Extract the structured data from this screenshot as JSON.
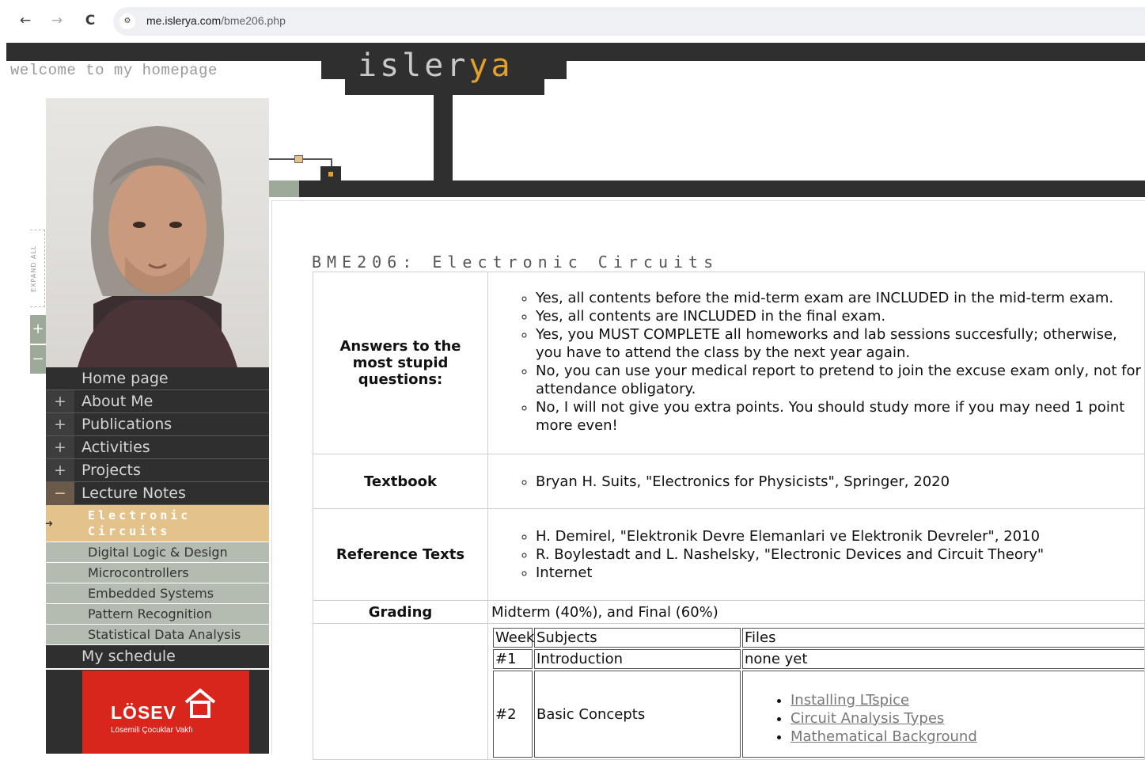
{
  "browser": {
    "url_host": "me.islerya.com",
    "url_path": "/bme206.php",
    "back_icon": "←",
    "forward_icon": "→",
    "reload_icon": "C",
    "site_info_icon": "⚙"
  },
  "header": {
    "welcome": "welcome to my homepage",
    "logo_main": "isler",
    "logo_accent": "ya",
    "accent_color": "#e3a12a"
  },
  "sidebar": {
    "expand_all": "EXPAND ALL",
    "plus": "+",
    "minus": "−",
    "menu": [
      {
        "label": "Home page",
        "sign": ""
      },
      {
        "label": "About Me",
        "sign": "+"
      },
      {
        "label": "Publications",
        "sign": "+"
      },
      {
        "label": "Activities",
        "sign": "+"
      },
      {
        "label": "Projects",
        "sign": "+"
      },
      {
        "label": "Lecture Notes",
        "sign": "−"
      }
    ],
    "lecture_notes": [
      "Electronic Circuits",
      "Digital Logic & Design",
      "Microcontrollers",
      "Embedded Systems",
      "Pattern Recognition",
      "Statistical Data Analysis"
    ],
    "schedule": "My schedule",
    "banner_name": "LÖSEV",
    "banner_sub": "Lösemili Çocuklar Vakfı"
  },
  "content": {
    "title": "BME206: Electronic Circuits",
    "rows": {
      "answers_label": "Answers to the most stupid questions:",
      "answers": [
        "Yes, all contents before the mid-term exam are INCLUDED in the mid-term exam.",
        "Yes, all contents are INCLUDED in the final exam.",
        "Yes, you MUST COMPLETE all homeworks and lab sessions succesfully; otherwise, you have to attend the class by the next year again.",
        "No, you can use your medical report to pretend to join the excuse exam only, not for attendance obligatory.",
        "No, I will not give you extra points. You should study more if you may need 1 point more even!"
      ],
      "textbook_label": "Textbook",
      "textbook": "Bryan H. Suits, \"Electronics for Physicists\", Springer, 2020",
      "reference_label": "Reference Texts",
      "references": [
        "H. Demirel, \"Elektronik Devre Elemanlari ve Elektronik Devreler\", 2010",
        "R. Boylestadt and L. Nashelsky, \"Electronic Devices and Circuit Theory\"",
        "Internet"
      ],
      "grading_label": "Grading",
      "grading": "Midterm (40%), and Final (60%)"
    },
    "weeks_header": {
      "week": "Week",
      "subjects": "Subjects",
      "files": "Files"
    },
    "weeks": [
      {
        "week": "#1",
        "subject": "Introduction",
        "files_text": "none yet"
      },
      {
        "week": "#2",
        "subject": "Basic Concepts",
        "links": [
          "Installing LTspice",
          "Circuit Analysis Types",
          "Mathematical Background"
        ]
      }
    ]
  }
}
